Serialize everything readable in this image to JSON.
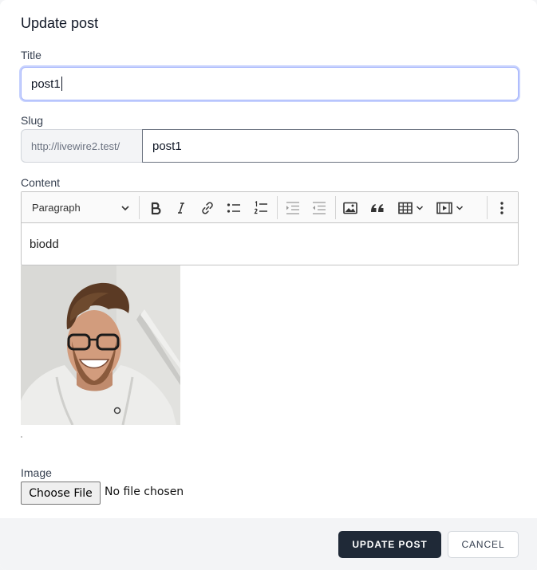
{
  "modal": {
    "title": "Update post"
  },
  "form": {
    "title_label": "Title",
    "title_value": "post1",
    "slug_label": "Slug",
    "slug_prefix": "http://livewire2.test/",
    "slug_value": "post1",
    "content_label": "Content",
    "content_text": "biodd",
    "image_label": "Image",
    "file_button_label": "Choose File",
    "file_status": "No file chosen"
  },
  "toolbar": {
    "heading_value": "Paragraph",
    "icons": [
      "bold-icon",
      "italic-icon",
      "link-icon",
      "bulleted-list-icon",
      "numbered-list-icon",
      "outdent-icon",
      "indent-icon",
      "image-icon",
      "blockquote-icon",
      "table-icon",
      "media-icon",
      "more-icon"
    ]
  },
  "footer": {
    "update_label": "UPDATE POST",
    "cancel_label": "CANCEL"
  },
  "colors": {
    "primary_button": "#1f2937",
    "focus_ring": "#c7d2fe"
  }
}
